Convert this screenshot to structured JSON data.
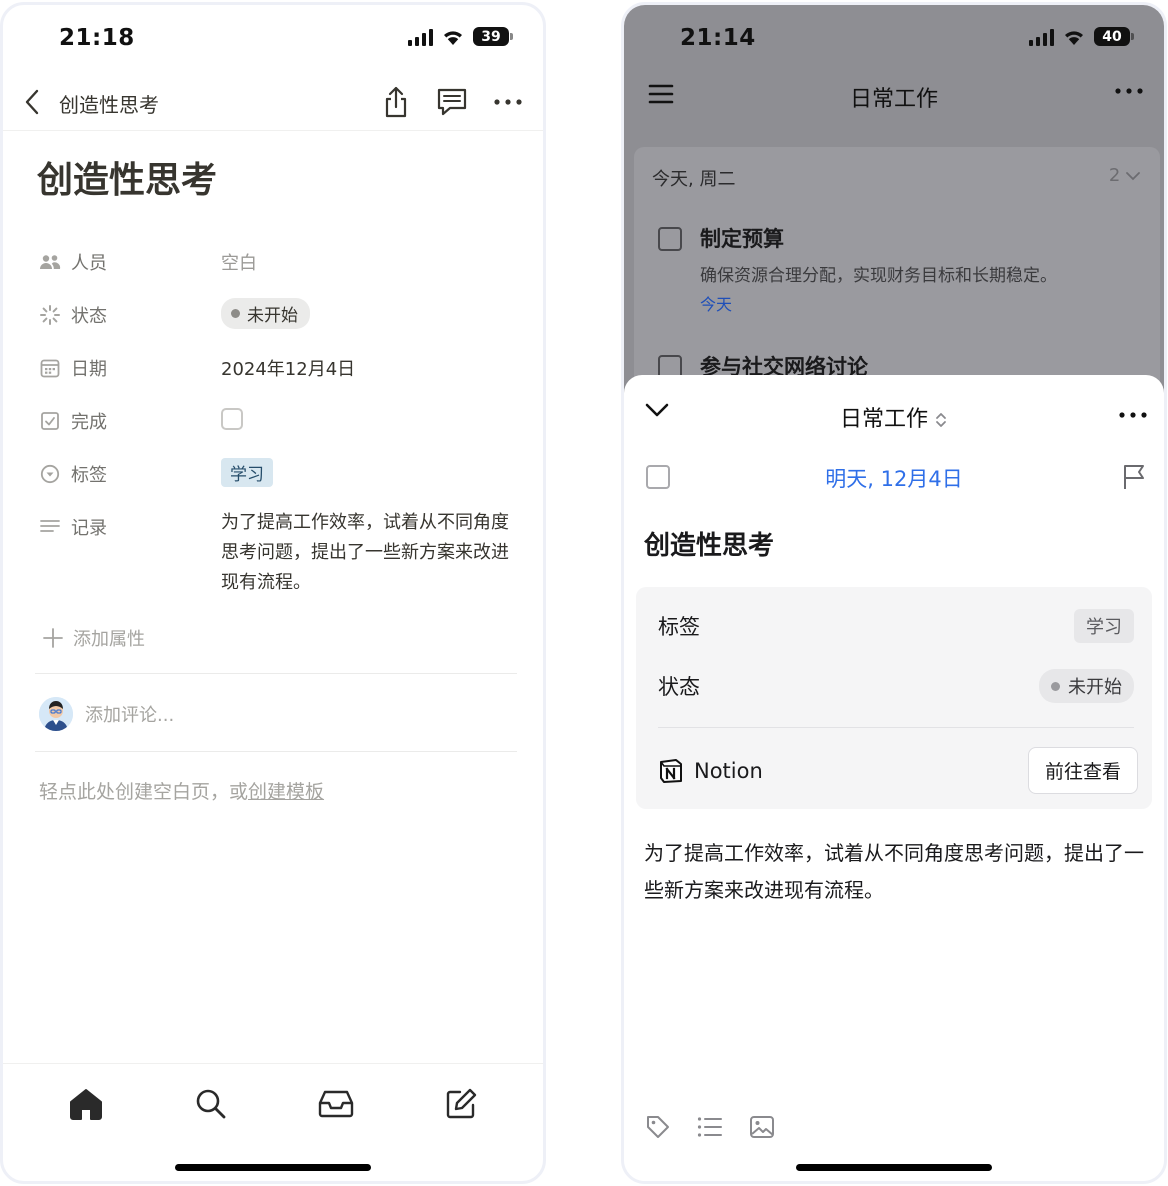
{
  "left": {
    "status": {
      "time": "21:18",
      "battery": "39"
    },
    "nav": {
      "title": "创造性思考"
    },
    "page_title": "创造性思考",
    "properties": [
      {
        "key": "人员",
        "value": "空白",
        "icon": "people-icon"
      },
      {
        "key": "状态",
        "value": "未开始",
        "icon": "status-loading-icon"
      },
      {
        "key": "日期",
        "value": "2024年12月4日",
        "icon": "calendar-icon"
      },
      {
        "key": "完成",
        "value": "",
        "icon": "checkbox-icon"
      },
      {
        "key": "标签",
        "value": "学习",
        "icon": "select-icon"
      },
      {
        "key": "记录",
        "value": "为了提高工作效率，试着从不同角度思考问题，提出了一些新方案来改进现有流程。",
        "icon": "text-lines-icon"
      }
    ],
    "add_property": "添加属性",
    "comment_placeholder": "添加评论...",
    "empty_hint": {
      "text": "轻点此处创建空白页，或",
      "link": "创建模板"
    },
    "tabs": [
      "home-icon",
      "search-icon",
      "inbox-icon",
      "compose-icon"
    ]
  },
  "right": {
    "status": {
      "time": "21:14",
      "battery": "40"
    },
    "background": {
      "title": "日常工作",
      "day": "今天, 周二",
      "count": "2",
      "task1": {
        "title": "制定预算",
        "desc": "确保资源合理分配，实现财务目标和长期稳定。",
        "date": "今天"
      },
      "task2": {
        "title": "参与社交网络讨论"
      }
    },
    "sheet": {
      "list_name": "日常工作",
      "due": "明天, 12月4日",
      "title": "创造性思考",
      "tag_label": "标签",
      "tag_value": "学习",
      "status_label": "状态",
      "status_value": "未开始",
      "integration": "Notion",
      "go_button": "前往查看",
      "note": "为了提高工作效率，试着从不同角度思考问题，提出了一些新方案来改进现有流程。",
      "tools": [
        "tag-icon",
        "list-icon",
        "image-icon"
      ]
    }
  },
  "colors": {
    "accent_blue": "#2f6fe8",
    "tag_blue_bg": "#d8e7f0",
    "overlay_gray": "#8e8e93"
  }
}
